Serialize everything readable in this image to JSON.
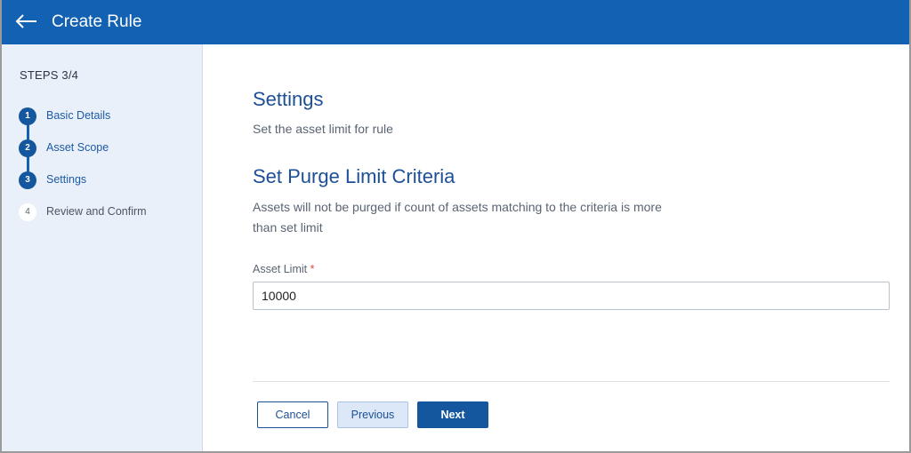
{
  "header": {
    "title": "Create Rule",
    "background_color": "#1261b3",
    "back_icon": "arrow-left-icon"
  },
  "sidebar": {
    "steps_label": "STEPS 3/4",
    "current_step": 3,
    "total_steps": 4,
    "steps": [
      {
        "number": "1",
        "label": "Basic Details",
        "state": "completed"
      },
      {
        "number": "2",
        "label": "Asset Scope",
        "state": "completed"
      },
      {
        "number": "3",
        "label": "Settings",
        "state": "current"
      },
      {
        "number": "4",
        "label": "Review and Confirm",
        "state": "pending"
      }
    ]
  },
  "main": {
    "heading": "Settings",
    "subheading": "Set the asset limit for rule",
    "section_title": "Set Purge Limit Criteria",
    "section_description": "Assets will not be purged if count of assets matching to the criteria is more than set limit",
    "field": {
      "label": "Asset Limit",
      "required_mark": "*",
      "value": "10000"
    }
  },
  "footer": {
    "cancel_label": "Cancel",
    "previous_label": "Previous",
    "next_label": "Next"
  },
  "colors": {
    "accent": "#1261b3",
    "heading": "#1d4f96",
    "required": "#d64a3a"
  }
}
